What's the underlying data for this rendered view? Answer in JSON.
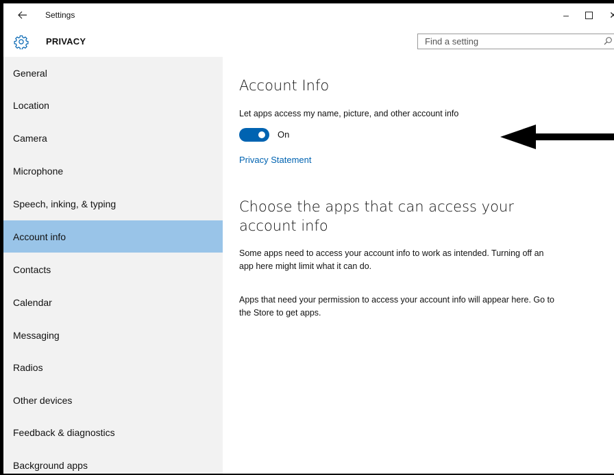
{
  "window": {
    "title": "Settings",
    "back_icon": "back-arrow-icon",
    "minimize_glyph": "–",
    "close_glyph": "✕"
  },
  "header": {
    "title": "PRIVACY",
    "icon": "gear-icon",
    "search_placeholder": "Find a setting"
  },
  "sidebar": {
    "items": [
      {
        "label": "General"
      },
      {
        "label": "Location"
      },
      {
        "label": "Camera"
      },
      {
        "label": "Microphone"
      },
      {
        "label": "Speech, inking, & typing"
      },
      {
        "label": "Account info",
        "selected": true
      },
      {
        "label": "Contacts"
      },
      {
        "label": "Calendar"
      },
      {
        "label": "Messaging"
      },
      {
        "label": "Radios"
      },
      {
        "label": "Other devices"
      },
      {
        "label": "Feedback & diagnostics"
      },
      {
        "label": "Background apps"
      }
    ],
    "selected_color": "#99c4e8"
  },
  "main": {
    "section1_title": "Account Info",
    "section1_desc": "Let apps access my name, picture, and other account info",
    "toggle_state": "On",
    "toggle_on": true,
    "toggle_color": "#0063b1",
    "link": "Privacy Statement",
    "section2_title": "Choose the apps that can access your account info",
    "section2_desc": "Some apps need to access your account info to work as intended. Turning off an app here might limit what it can do.",
    "section2_note": "Apps that need your permission to access your account info will appear here. Go to the Store to get apps."
  },
  "annotation": {
    "icon": "left-arrow-annotation-icon",
    "color": "#000000"
  }
}
